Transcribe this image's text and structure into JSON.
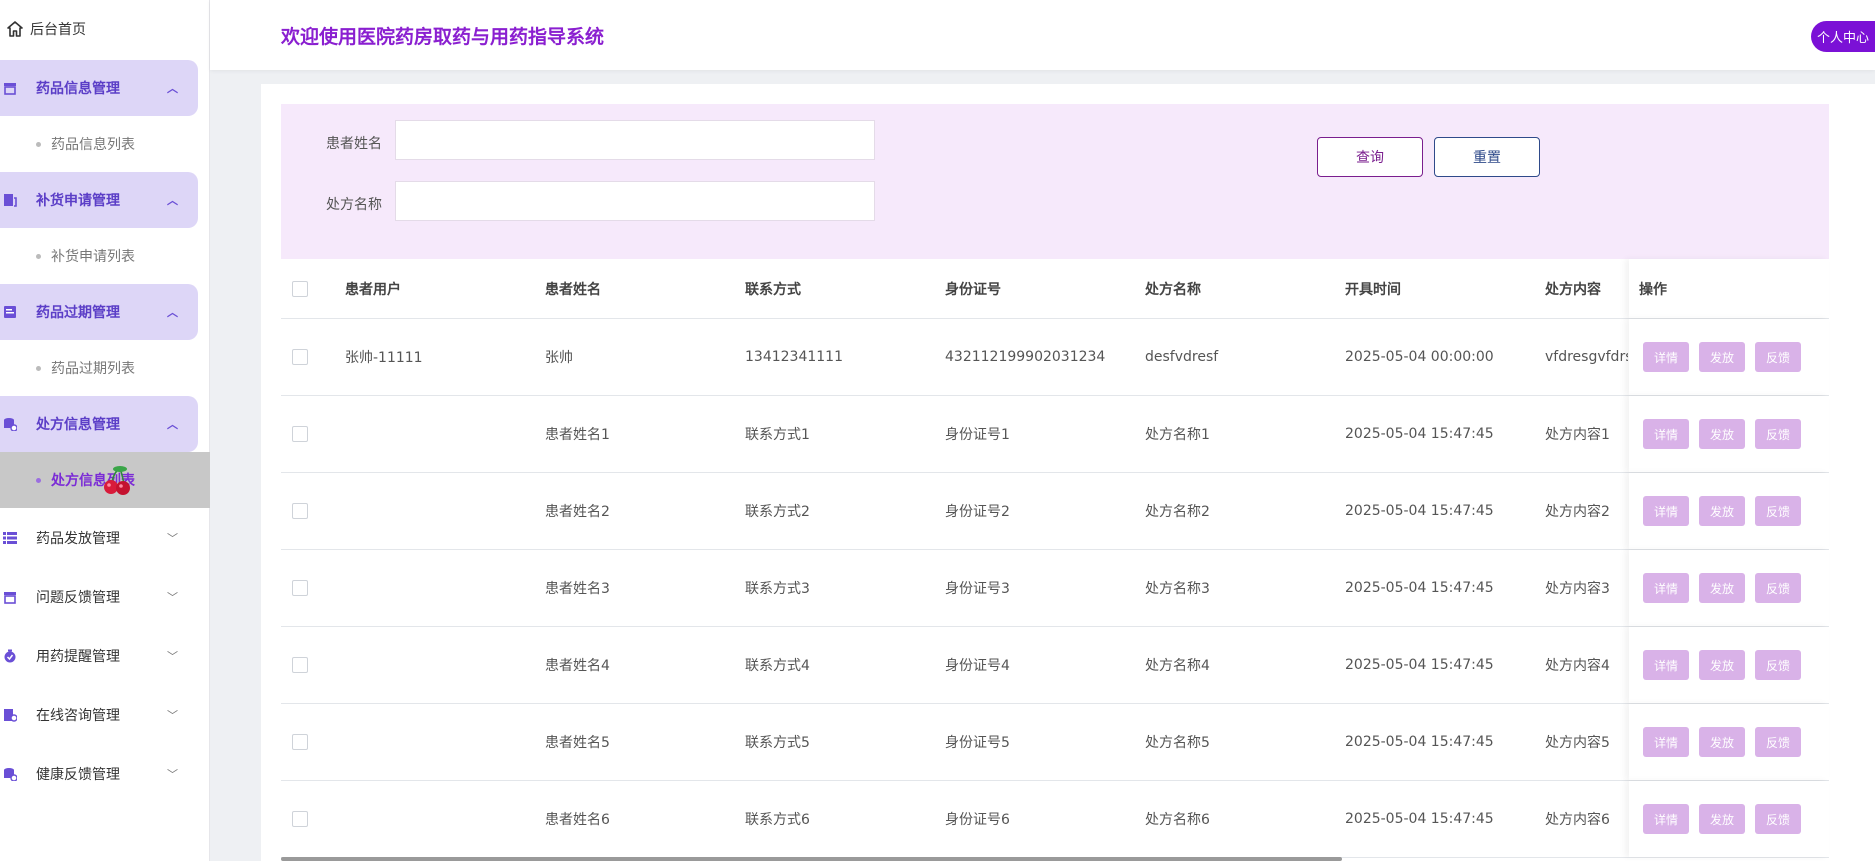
{
  "sidebar": {
    "home_label": "后台首页",
    "groups": [
      {
        "label": "药品信息管理",
        "open": true,
        "items": [
          "药品信息列表"
        ]
      },
      {
        "label": "补货申请管理",
        "open": true,
        "items": [
          "补货申请列表"
        ]
      },
      {
        "label": "药品过期管理",
        "open": true,
        "items": [
          "药品过期列表"
        ]
      },
      {
        "label": "处方信息管理",
        "open": true,
        "items": [
          "处方信息列表"
        ]
      },
      {
        "label": "药品发放管理",
        "open": false
      },
      {
        "label": "问题反馈管理",
        "open": false
      },
      {
        "label": "用药提醒管理",
        "open": false
      },
      {
        "label": "在线咨询管理",
        "open": false
      },
      {
        "label": "健康反馈管理",
        "open": false
      }
    ],
    "active_item": "处方信息列表"
  },
  "header": {
    "title": "欢迎使用医院药房取药与用药指导系统",
    "user_button": "个人中心"
  },
  "search": {
    "patient_name_label": "患者姓名",
    "patient_name_value": "",
    "prescription_name_label": "处方名称",
    "prescription_name_value": "",
    "search_button": "查询",
    "reset_button": "重置"
  },
  "table": {
    "columns": [
      "患者用户",
      "患者姓名",
      "联系方式",
      "身份证号",
      "处方名称",
      "开具时间",
      "处方内容",
      "操作"
    ],
    "action_labels": [
      "详情",
      "发放",
      "反馈"
    ],
    "rows": [
      [
        "张帅-11111",
        "张帅",
        "13412341111",
        "432112199902031234",
        "desfvdresf",
        "2025-05-04 00:00:00",
        "vfdresgvfdrs"
      ],
      [
        "",
        "患者姓名1",
        "联系方式1",
        "身份证号1",
        "处方名称1",
        "2025-05-04 15:47:45",
        "处方内容1"
      ],
      [
        "",
        "患者姓名2",
        "联系方式2",
        "身份证号2",
        "处方名称2",
        "2025-05-04 15:47:45",
        "处方内容2"
      ],
      [
        "",
        "患者姓名3",
        "联系方式3",
        "身份证号3",
        "处方名称3",
        "2025-05-04 15:47:45",
        "处方内容3"
      ],
      [
        "",
        "患者姓名4",
        "联系方式4",
        "身份证号4",
        "处方名称4",
        "2025-05-04 15:47:45",
        "处方内容4"
      ],
      [
        "",
        "患者姓名5",
        "联系方式5",
        "身份证号5",
        "处方名称5",
        "2025-05-04 15:47:45",
        "处方内容5"
      ],
      [
        "",
        "患者姓名6",
        "联系方式6",
        "身份证号6",
        "处方名称6",
        "2025-05-04 15:47:45",
        "处方内容6"
      ]
    ]
  },
  "colors": {
    "accent": "#7b11d6",
    "menu_open_bg": "#ddd6f7",
    "search_panel_bg": "#f6e9fb",
    "action_button_bg": "#d9b2e8"
  }
}
